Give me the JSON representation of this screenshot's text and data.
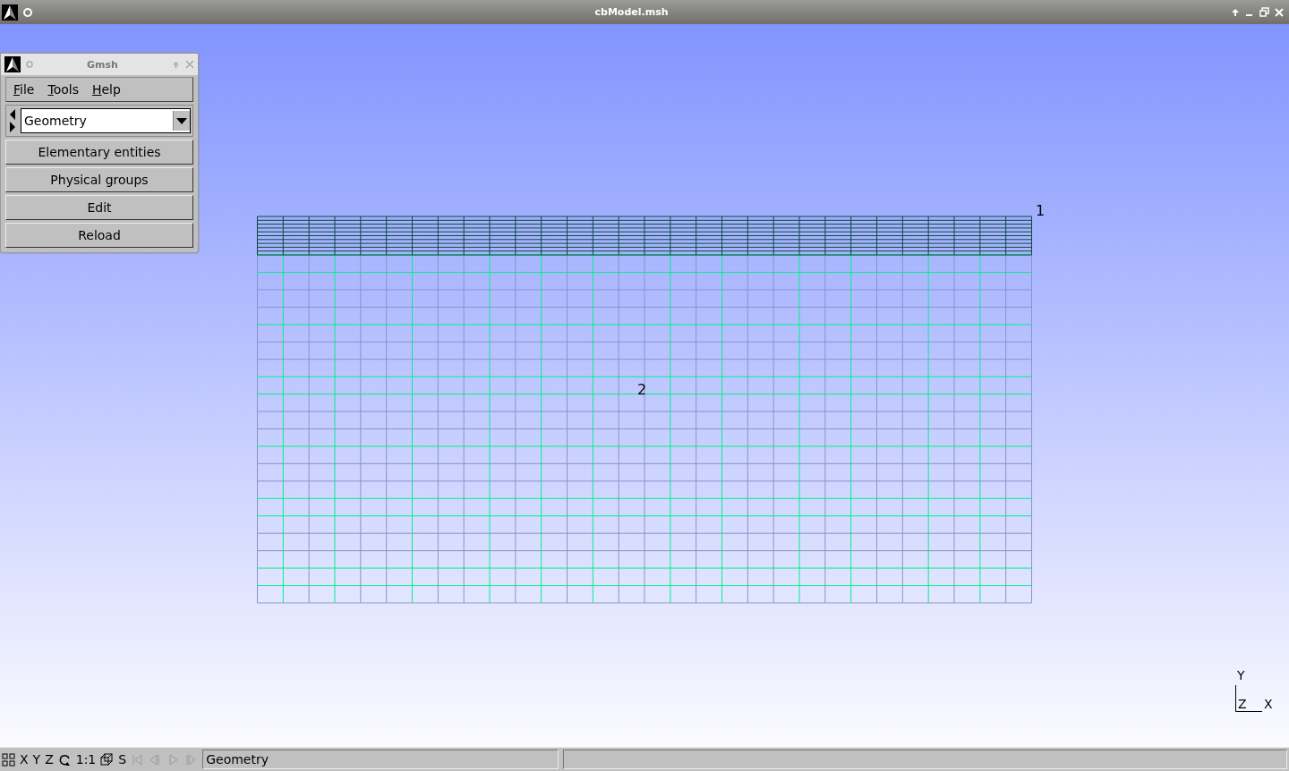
{
  "window": {
    "title": "cbModel.msh"
  },
  "panel": {
    "title": "Gmsh",
    "menu": [
      "File",
      "Tools",
      "Help"
    ],
    "module": {
      "value": "Geometry"
    },
    "buttons": [
      "Elementary entities",
      "Physical groups",
      "Edit",
      "Reload"
    ]
  },
  "viewport": {
    "labels": [
      {
        "text": "1",
        "kind": "band"
      },
      {
        "text": "2",
        "kind": "body"
      }
    ],
    "axes": {
      "y": "Y",
      "z": "Z",
      "x": "X"
    }
  },
  "status_bar": {
    "tools": [
      {
        "kind": "icon",
        "disabled": false
      },
      {
        "kind": "text",
        "text": "X"
      },
      {
        "kind": "text",
        "text": "Y"
      },
      {
        "kind": "text",
        "text": "Z"
      },
      {
        "kind": "icon",
        "disabled": false
      },
      {
        "kind": "text",
        "text": "1:1"
      },
      {
        "kind": "icon",
        "disabled": false
      },
      {
        "kind": "text",
        "text": "S"
      },
      {
        "kind": "icon",
        "disabled": true
      },
      {
        "kind": "icon",
        "disabled": true
      },
      {
        "kind": "icon",
        "disabled": true
      },
      {
        "kind": "icon",
        "disabled": true
      }
    ],
    "message": "Geometry"
  }
}
